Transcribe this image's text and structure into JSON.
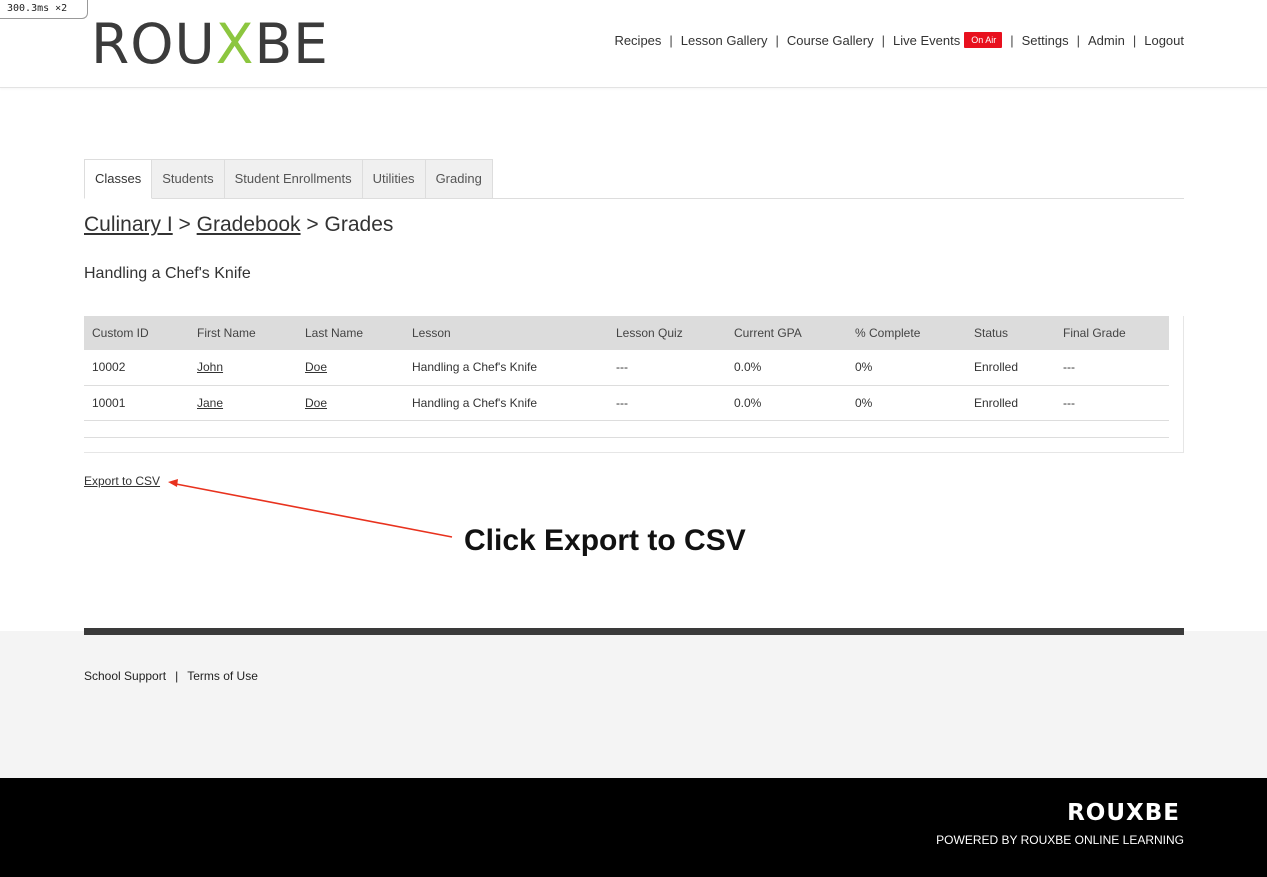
{
  "perf_badge": "300.3ms ×2",
  "brand": {
    "pre": "ROU",
    "x": "X",
    "post": "BE"
  },
  "nav": {
    "items": [
      "Recipes",
      "Lesson Gallery",
      "Course Gallery",
      "Live Events"
    ],
    "on_air": "On Air",
    "items2": [
      "Settings",
      "Admin",
      "Logout"
    ]
  },
  "tabs": [
    "Classes",
    "Students",
    "Student Enrollments",
    "Utilities",
    "Grading"
  ],
  "breadcrumb": {
    "course": "Culinary I",
    "sep": ">",
    "gradebook": "Gradebook",
    "current": "Grades"
  },
  "lesson_title": "Handling a Chef's Knife",
  "table": {
    "headers": [
      "Custom ID",
      "First Name",
      "Last Name",
      "Lesson",
      "Lesson Quiz",
      "Current GPA",
      "% Complete",
      "Status",
      "Final Grade"
    ],
    "rows": [
      [
        "10002",
        "John",
        "Doe",
        "Handling a Chef's Knife",
        "---",
        "0.0%",
        "0%",
        "Enrolled",
        "---"
      ],
      [
        "10001",
        "Jane",
        "Doe",
        "Handling a Chef's Knife",
        "---",
        "0.0%",
        "0%",
        "Enrolled",
        "---"
      ]
    ]
  },
  "export_label": "Export to CSV",
  "annotation": "Click Export to CSV",
  "footer": {
    "links": [
      "School Support",
      "Terms of Use"
    ]
  },
  "bottom": {
    "logo": "ROUXBE",
    "powered": "POWERED BY ROUXBE ONLINE LEARNING"
  },
  "colors": {
    "accent_green": "#8cc63f",
    "on_air_red": "#e8101e",
    "arrow_red": "#e8321e"
  }
}
